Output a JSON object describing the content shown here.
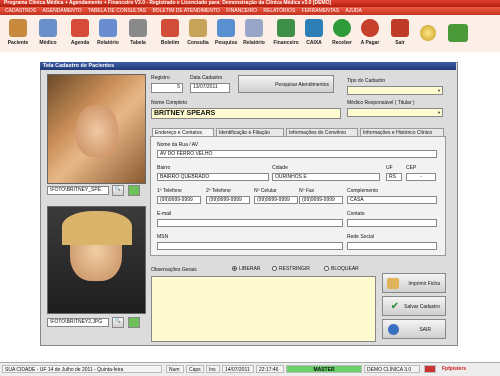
{
  "window": {
    "title": "Programa Clínica Médica + Agendamento + Financeiro V3.0 - Registrado e Licenciado para: Demonstração da Clínica Médica v3.0 [DEMO]"
  },
  "menu": [
    "CADASTROS",
    "AGENDAMENTO",
    "TABELA DE CONSULTAS",
    "BOLETIM DE ATENDIMENTO",
    "FINANCEIRO",
    "RELATÓRIOS",
    "FERRAMENTAS",
    "AJUDA"
  ],
  "toolbar": [
    {
      "label": "Paciente",
      "color": "#c9893d"
    },
    {
      "label": "Médico",
      "color": "#6a8fc9"
    },
    {
      "label": "Agenda",
      "color": "#d64a3a"
    },
    {
      "label": "Relatório",
      "color": "#6b8ccf"
    },
    {
      "label": "Tabela",
      "color": "#8a8a8a"
    },
    {
      "label": "Boletim",
      "color": "#d14d3a"
    },
    {
      "label": "Consulta",
      "color": "#c7a35a"
    },
    {
      "label": "Pesquisa",
      "color": "#5a8fd0"
    },
    {
      "label": "Relatório",
      "color": "#9aa6c8"
    },
    {
      "label": "Financeiro",
      "color": "#3e8f4a"
    },
    {
      "label": "CAIXA",
      "color": "#2d7fb8"
    },
    {
      "label": "Receber",
      "color": "#2f9a3a"
    },
    {
      "label": "A Pagar",
      "color": "#c7402c"
    },
    {
      "label": "Sair",
      "color": "#c03a2a"
    }
  ],
  "form": {
    "title": "Tela Cadastro de Pacientes",
    "registro_label": "Registro",
    "registro": "5",
    "data_cadastro_label": "Data Cadastro",
    "data_cadastro": "13/07/2011",
    "pesquisar_btn": "Pesquisar Atendimentos",
    "tipo_cadastro_label": "Tipo do Cadastro",
    "nome_label": "Nome Completo",
    "nome": "BRITNEY SPEARS",
    "medico_label": "Médico Responsável ( Titular )",
    "photo1_path": "\\FOTO\\BRITNEY_SPE",
    "photo2_path": "\\FOTO\\BRITNEY2.JPG",
    "tabs": [
      "Endereço e Contatos",
      "Identificação e Filiação",
      "Informações do Convênio",
      "Informações e Histórico Clínico"
    ],
    "rua_label": "Nome da Rua / AV",
    "rua": "AV DO FERRO VELHO",
    "bairro_label": "Bairro",
    "bairro": "BAIRRO QUEBRADO",
    "cidade_label": "Cidade",
    "cidade": "OURINHOS E",
    "uf_label": "UF",
    "uf": "RS",
    "cep_label": "CEP",
    "cep": "-",
    "tel1_label": "1º Telefone",
    "tel1": "(99)9999-9999",
    "tel2_label": "2º Telefone",
    "tel2": "(99)9999-9999",
    "cel_label": "Nº Celular",
    "cel": "(99)9999-9999",
    "fax_label": "Nº Fax",
    "fax": "(99)9999-9999",
    "complemento_label": "Complemento",
    "complemento": "CASA",
    "email_label": "E-mail",
    "contato_label": "Contato",
    "msn_label": "MSN",
    "rede_label": "Rede Social",
    "obs_label": "Observações Gerais",
    "radio_liberar": "LIBERAR",
    "radio_restringir": "RESTRINGIR",
    "radio_bloquear": "BLOQUEAR",
    "btn_imprimir": "Imprimir Ficha",
    "btn_salvar": "Salvar Cadastro",
    "btn_sair": "SAIR"
  },
  "status": {
    "city": "SUA CIDADE - UF 14 de Julho de 2011 - Quinta-feira",
    "num": "Num",
    "caps": "Caps",
    "ins": "Ins",
    "date": "14/07/2011",
    "time": "22:17:46",
    "master": "MASTER",
    "app": "DEMO CLÍNICA 3.0",
    "brand": "Fpfpisters"
  }
}
